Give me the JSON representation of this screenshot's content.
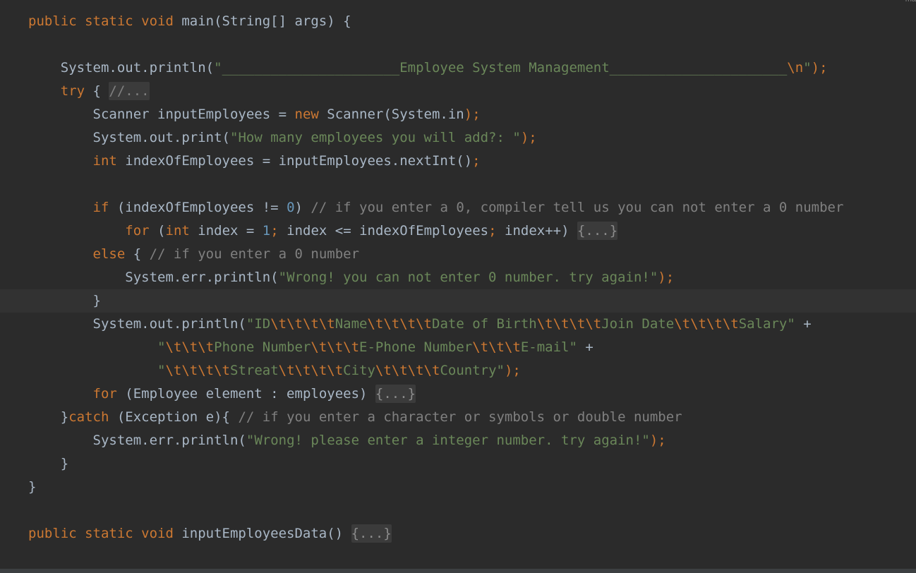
{
  "editor": {
    "current_line_index": 12,
    "top_fragment": "ma",
    "lines": [
      [
        {
          "t": "public static void",
          "c": "kw"
        },
        {
          "t": " main(String[] args) {",
          "c": "p"
        }
      ],
      [],
      [
        {
          "t": "    System.",
          "c": "p"
        },
        {
          "t": "out",
          "c": "p"
        },
        {
          "t": ".println(",
          "c": "p"
        },
        {
          "t": "\"______________________Employee System Management______________________",
          "c": "str"
        },
        {
          "t": "\\n",
          "c": "esc"
        },
        {
          "t": "\"",
          "c": "str"
        },
        {
          "t": ");",
          "c": "punc"
        }
      ],
      [
        {
          "t": "    ",
          "c": "p"
        },
        {
          "t": "try",
          "c": "kw"
        },
        {
          "t": " { ",
          "c": "p"
        },
        {
          "t": "//...",
          "c": "fold-cmt"
        }
      ],
      [
        {
          "t": "        Scanner inputEmployees = ",
          "c": "p"
        },
        {
          "t": "new",
          "c": "kw"
        },
        {
          "t": " Scanner(System.",
          "c": "p"
        },
        {
          "t": "in",
          "c": "p"
        },
        {
          "t": ");",
          "c": "punc"
        }
      ],
      [
        {
          "t": "        System.",
          "c": "p"
        },
        {
          "t": "out",
          "c": "p"
        },
        {
          "t": ".print(",
          "c": "p"
        },
        {
          "t": "\"How many employees you will add?: \"",
          "c": "str"
        },
        {
          "t": ");",
          "c": "punc"
        }
      ],
      [
        {
          "t": "        ",
          "c": "p"
        },
        {
          "t": "int",
          "c": "kw"
        },
        {
          "t": " indexOfEmployees = inputEmployees.nextInt()",
          "c": "p"
        },
        {
          "t": ";",
          "c": "punc"
        }
      ],
      [],
      [
        {
          "t": "        ",
          "c": "p"
        },
        {
          "t": "if",
          "c": "kw"
        },
        {
          "t": " (indexOfEmployees != ",
          "c": "p"
        },
        {
          "t": "0",
          "c": "num"
        },
        {
          "t": ") ",
          "c": "p"
        },
        {
          "t": "// if you enter a 0, compiler tell us you can not enter a 0 number",
          "c": "cmt"
        }
      ],
      [
        {
          "t": "            ",
          "c": "p"
        },
        {
          "t": "for",
          "c": "kw"
        },
        {
          "t": " (",
          "c": "p"
        },
        {
          "t": "int",
          "c": "kw"
        },
        {
          "t": " index = ",
          "c": "p"
        },
        {
          "t": "1",
          "c": "num"
        },
        {
          "t": ";",
          "c": "punc"
        },
        {
          "t": " index <= indexOfEmployees",
          "c": "p"
        },
        {
          "t": ";",
          "c": "punc"
        },
        {
          "t": " index++) ",
          "c": "p"
        },
        {
          "t": "{...}",
          "c": "fold"
        }
      ],
      [
        {
          "t": "        ",
          "c": "p"
        },
        {
          "t": "else",
          "c": "kw"
        },
        {
          "t": " { ",
          "c": "p"
        },
        {
          "t": "// if you enter a 0 number",
          "c": "cmt"
        }
      ],
      [
        {
          "t": "            System.",
          "c": "p"
        },
        {
          "t": "err",
          "c": "p"
        },
        {
          "t": ".println(",
          "c": "p"
        },
        {
          "t": "\"Wrong! you can not enter 0 number. try again!\"",
          "c": "str"
        },
        {
          "t": ");",
          "c": "punc"
        }
      ],
      [
        {
          "t": "        }",
          "c": "p"
        }
      ],
      [
        {
          "t": "        System.",
          "c": "p"
        },
        {
          "t": "out",
          "c": "p"
        },
        {
          "t": ".println(",
          "c": "p"
        },
        {
          "t": "\"ID",
          "c": "str"
        },
        {
          "t": "\\t\\t\\t\\t",
          "c": "esc"
        },
        {
          "t": "Name",
          "c": "str"
        },
        {
          "t": "\\t\\t\\t\\t",
          "c": "esc"
        },
        {
          "t": "Date of Birth",
          "c": "str"
        },
        {
          "t": "\\t\\t\\t\\t",
          "c": "esc"
        },
        {
          "t": "Join Date",
          "c": "str"
        },
        {
          "t": "\\t\\t\\t\\t",
          "c": "esc"
        },
        {
          "t": "Salary\"",
          "c": "str"
        },
        {
          "t": " +",
          "c": "p"
        }
      ],
      [
        {
          "t": "                ",
          "c": "p"
        },
        {
          "t": "\"",
          "c": "str"
        },
        {
          "t": "\\t\\t\\t",
          "c": "esc"
        },
        {
          "t": "Phone Number",
          "c": "str"
        },
        {
          "t": "\\t\\t\\t",
          "c": "esc"
        },
        {
          "t": "E-Phone Number",
          "c": "str"
        },
        {
          "t": "\\t\\t\\t",
          "c": "esc"
        },
        {
          "t": "E-mail\"",
          "c": "str"
        },
        {
          "t": " +",
          "c": "p"
        }
      ],
      [
        {
          "t": "                ",
          "c": "p"
        },
        {
          "t": "\"",
          "c": "str"
        },
        {
          "t": "\\t\\t\\t\\t",
          "c": "esc"
        },
        {
          "t": "Streat",
          "c": "str"
        },
        {
          "t": "\\t\\t\\t\\t",
          "c": "esc"
        },
        {
          "t": "City",
          "c": "str"
        },
        {
          "t": "\\t\\t\\t\\t",
          "c": "esc"
        },
        {
          "t": "Country\"",
          "c": "str"
        },
        {
          "t": ");",
          "c": "punc"
        }
      ],
      [
        {
          "t": "        ",
          "c": "p"
        },
        {
          "t": "for",
          "c": "kw"
        },
        {
          "t": " (Employee element : employees) ",
          "c": "p"
        },
        {
          "t": "{...}",
          "c": "fold"
        }
      ],
      [
        {
          "t": "    }",
          "c": "p"
        },
        {
          "t": "catch",
          "c": "kw"
        },
        {
          "t": " (Exception e){ ",
          "c": "p"
        },
        {
          "t": "// if you enter a character or symbols or double number",
          "c": "cmt"
        }
      ],
      [
        {
          "t": "        System.",
          "c": "p"
        },
        {
          "t": "err",
          "c": "p"
        },
        {
          "t": ".println(",
          "c": "p"
        },
        {
          "t": "\"Wrong! please enter a integer number. try again!\"",
          "c": "str"
        },
        {
          "t": ");",
          "c": "punc"
        }
      ],
      [
        {
          "t": "    }",
          "c": "p"
        }
      ],
      [
        {
          "t": "}",
          "c": "p"
        }
      ],
      [],
      [
        {
          "t": "public static void",
          "c": "kw"
        },
        {
          "t": " inputEmployeesData() ",
          "c": "p"
        },
        {
          "t": "{...}",
          "c": "fold"
        }
      ]
    ]
  },
  "colors": {
    "background": "#2b2b2b",
    "current_line": "#323232",
    "keyword": "#cc7832",
    "string": "#6a8759",
    "comment": "#808080",
    "number": "#6897bb",
    "plain": "#a9b7c6",
    "fold_bg": "#3b3b3b"
  }
}
